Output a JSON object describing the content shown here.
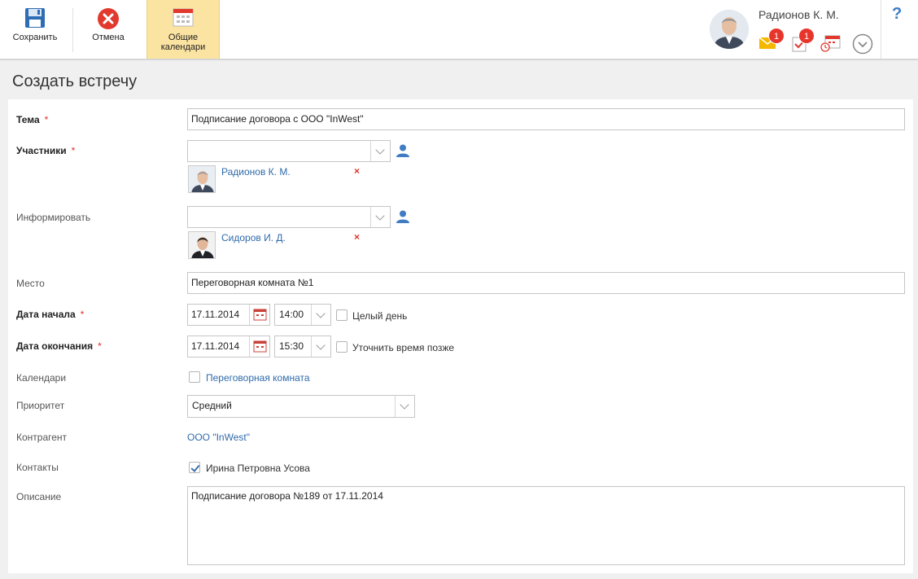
{
  "toolbar": {
    "save_label": "Сохранить",
    "cancel_label": "Отмена",
    "calendars_label_1": "Общие",
    "calendars_label_2": "календари"
  },
  "user": {
    "name": "Радионов К. М.",
    "mail_badge": "1",
    "tasks_badge": "1"
  },
  "help_label": "?",
  "page_title": "Создать встречу",
  "form": {
    "subject": {
      "label": "Тема",
      "required_mark": "*",
      "value": "Подписание договора с ООО \"InWest\""
    },
    "participants": {
      "label": "Участники",
      "required_mark": "*",
      "value": "",
      "person_name": "Радионов К. М.",
      "remove": "×"
    },
    "inform": {
      "label": "Информировать",
      "value": "",
      "person_name": "Сидоров И. Д.",
      "remove": "×"
    },
    "place": {
      "label": "Место",
      "value": "Переговорная комната №1"
    },
    "start": {
      "label": "Дата начала",
      "required_mark": "*",
      "date": "17.11.2014",
      "time": "14:00",
      "all_day_label": "Целый день",
      "all_day_checked": false
    },
    "end": {
      "label": "Дата окончания",
      "required_mark": "*",
      "date": "17.11.2014",
      "time": "15:30",
      "later_label": "Уточнить время позже",
      "later_checked": false
    },
    "calendars": {
      "label": "Календари",
      "option": "Переговорная комната",
      "checked": false
    },
    "priority": {
      "label": "Приоритет",
      "value": "Средний"
    },
    "counterparty": {
      "label": "Контрагент",
      "value": "ООО \"InWest\""
    },
    "contacts": {
      "label": "Контакты",
      "value": "Ирина Петровна Усова",
      "checked": true
    },
    "description": {
      "label": "Описание",
      "value": "Подписание договора №189 от 17.11.2014"
    }
  },
  "colors": {
    "accent": "#3f7cc4",
    "badge": "#e8352b",
    "active_toolbar": "#fbe3a1",
    "link": "#2f6aab"
  },
  "icons": [
    "save-icon",
    "cancel-icon",
    "calendar-icon",
    "mail-icon",
    "tasks-icon",
    "events-icon",
    "chevron-down-circle-icon",
    "person-icon",
    "remove-icon"
  ]
}
